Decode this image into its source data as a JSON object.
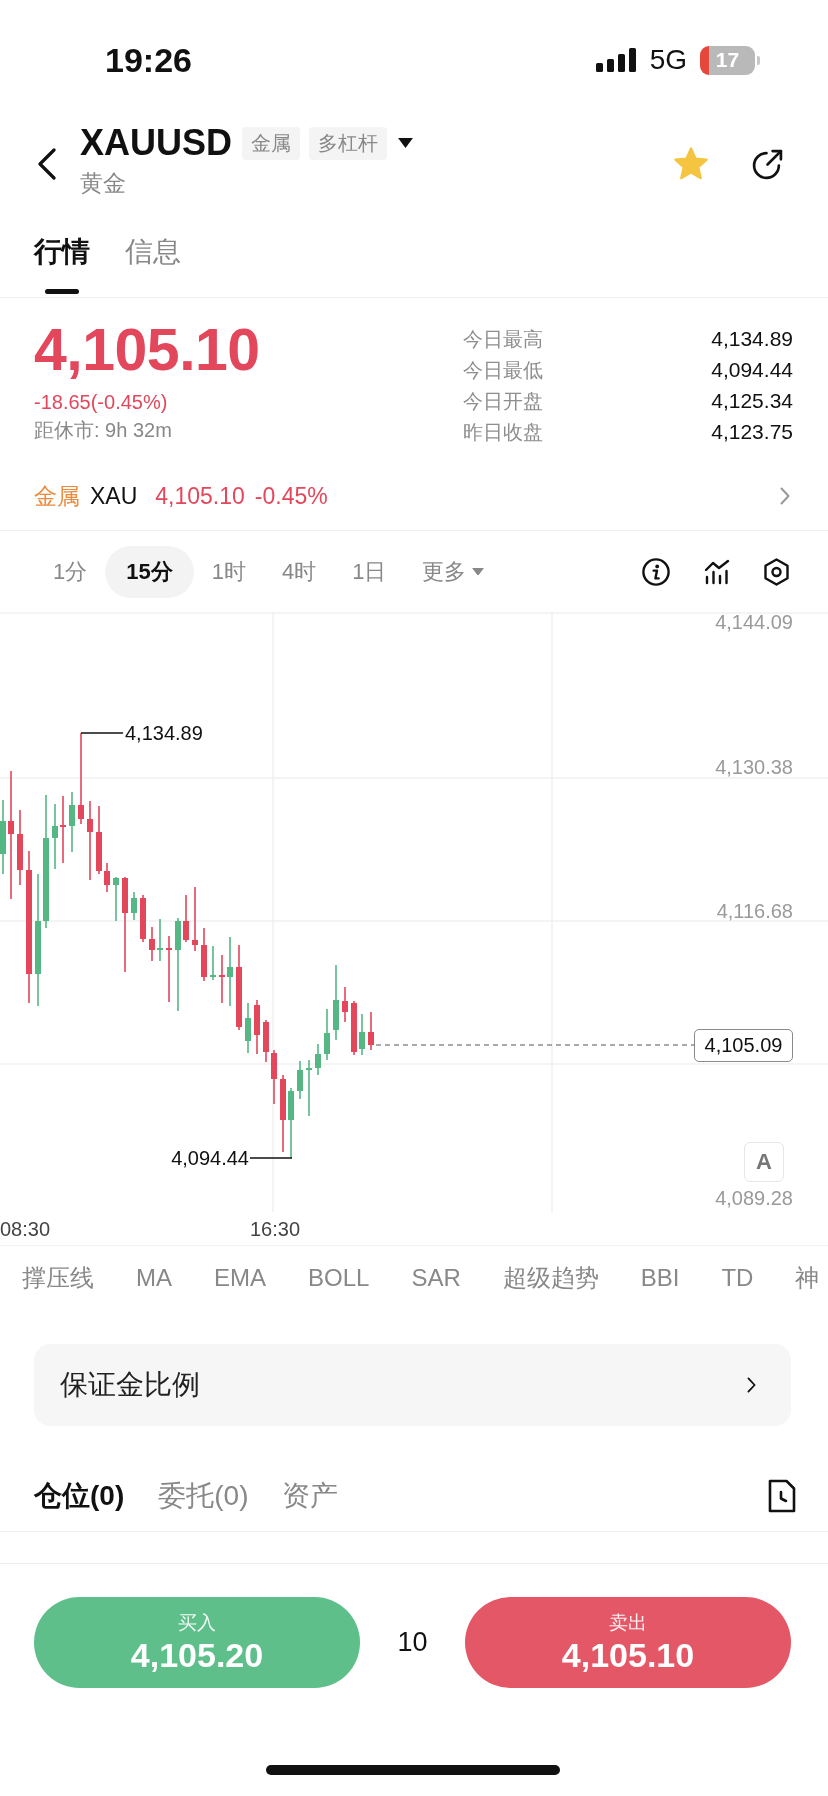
{
  "status_bar": {
    "time": "19:26",
    "network": "5G",
    "battery": "17"
  },
  "header": {
    "symbol": "XAUUSD",
    "tags": [
      "金属",
      "多杠杆"
    ],
    "subtitle": "黄金",
    "favorited": true
  },
  "tabs": [
    {
      "label": "行情",
      "selected": true
    },
    {
      "label": "信息",
      "selected": false
    }
  ],
  "quote": {
    "price": "4,105.10",
    "change": "-18.65(-0.45%)",
    "negative": true,
    "session": "距休市: 9h 32m",
    "stats": [
      {
        "label": "今日最高",
        "value": "4,134.89"
      },
      {
        "label": "今日最低",
        "value": "4,094.44"
      },
      {
        "label": "今日开盘",
        "value": "4,125.34"
      },
      {
        "label": "昨日收盘",
        "value": "4,123.75"
      }
    ]
  },
  "related": {
    "category": "金属",
    "symbol": "XAU",
    "price": "4,105.10",
    "change": "-0.45%",
    "negative": true
  },
  "timeframes": [
    {
      "label": "1分",
      "selected": false,
      "kind": "interval"
    },
    {
      "label": "15分",
      "selected": true,
      "kind": "interval"
    },
    {
      "label": "1时",
      "selected": false,
      "kind": "interval"
    },
    {
      "label": "4时",
      "selected": false,
      "kind": "interval"
    },
    {
      "label": "1日",
      "selected": false,
      "kind": "interval"
    },
    {
      "label": "更多",
      "selected": false,
      "kind": "menu"
    }
  ],
  "chart": {
    "price_axis": [
      "4,144.09",
      "4,130.38",
      "4,116.68",
      "4,089.28"
    ],
    "time_axis": [
      "08:30",
      "16:30"
    ],
    "high_marker": "4,134.89",
    "low_marker": "4,094.44",
    "last_price": "4,105.09",
    "scale_button": "A"
  },
  "indicators": [
    "撑压线",
    "MA",
    "EMA",
    "BOLL",
    "SAR",
    "超级趋势",
    "BBI",
    "TD",
    "神"
  ],
  "margin_ratio": {
    "label": "保证金比例"
  },
  "position_tabs": [
    {
      "label": "仓位(0)",
      "selected": true
    },
    {
      "label": "委托(0)",
      "selected": false
    },
    {
      "label": "资产",
      "selected": false
    }
  ],
  "trade_bar": {
    "buy": {
      "label": "买入",
      "price": "4,105.20"
    },
    "quantity": "10",
    "sell": {
      "label": "卖出",
      "price": "4,105.10"
    }
  }
}
